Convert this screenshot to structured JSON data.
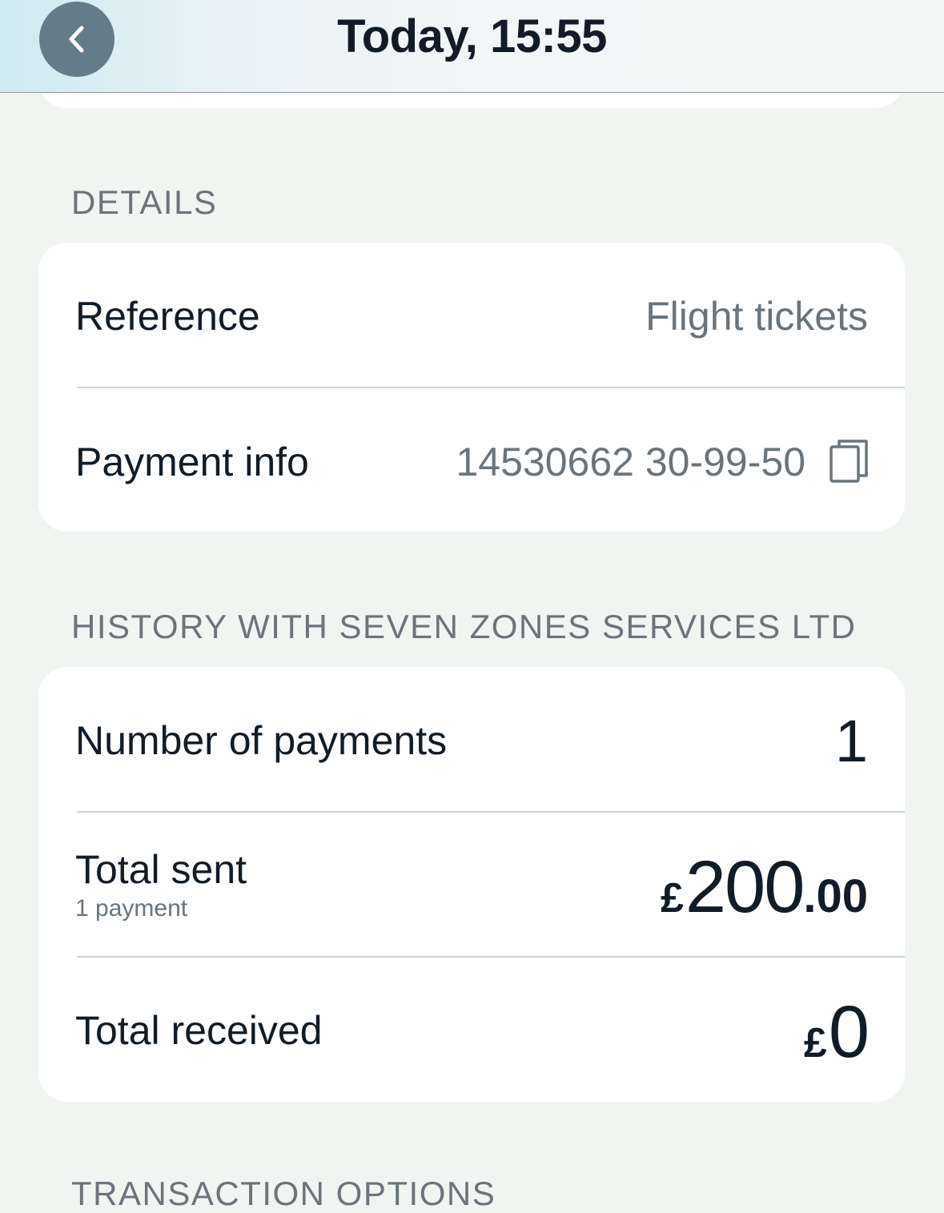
{
  "header": {
    "title": "Today, 15:55",
    "back_icon": "chevron-left-icon"
  },
  "details": {
    "section_label": "DETAILS",
    "reference_label": "Reference",
    "reference_value": "Flight tickets",
    "payment_info_label": "Payment info",
    "payment_info_value": "14530662 30-99-50",
    "copy_icon": "copy-icon"
  },
  "history": {
    "section_label": "HISTORY WITH SEVEN ZONES SERVICES LTD",
    "number_of_payments_label": "Number of payments",
    "number_of_payments_value": "1",
    "total_sent_label": "Total sent",
    "total_sent_sub": "1 payment",
    "total_sent_currency": "£",
    "total_sent_whole": "200",
    "total_sent_fraction": ".00",
    "total_received_label": "Total received",
    "total_received_currency": "£",
    "total_received_whole": "0"
  },
  "transaction_options": {
    "section_label": "TRANSACTION OPTIONS"
  },
  "colors": {
    "background": "#f1f5f2",
    "card": "#ffffff",
    "primary_text": "#111c27",
    "secondary_text": "#6a747b",
    "back_button": "#647b89"
  }
}
